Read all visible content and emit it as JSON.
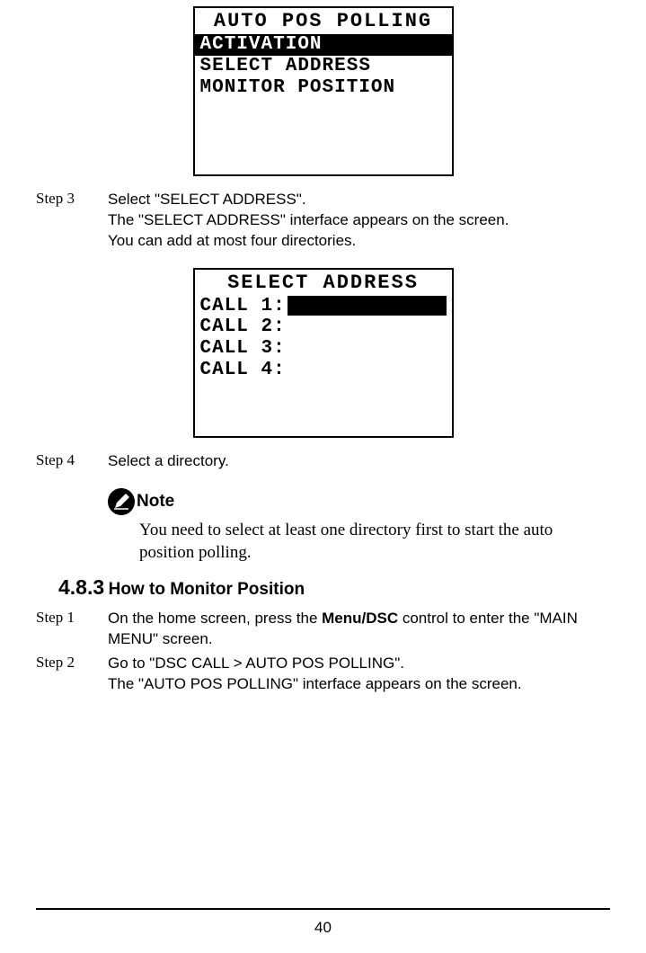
{
  "screen1": {
    "title": "AUTO POS POLLING",
    "items": [
      "ACTIVATION",
      "SELECT ADDRESS",
      "MONITOR POSITION"
    ]
  },
  "step3": {
    "label": "Step 3",
    "line1": "Select \"SELECT ADDRESS\".",
    "line2": "The \"SELECT ADDRESS\" interface appears on the screen.",
    "line3": "You can add at most four directories."
  },
  "screen2": {
    "title": "SELECT ADDRESS",
    "calls": [
      "CALL 1:",
      "CALL 2:",
      "CALL 3:",
      "CALL 4:"
    ]
  },
  "step4": {
    "label": "Step 4",
    "text": "Select a directory."
  },
  "note": {
    "title": "Note",
    "text": "You need to select at least one directory first to start the auto position polling."
  },
  "section": {
    "number": "4.8.3",
    "title": "How to Monitor Position"
  },
  "step1": {
    "label": "Step 1",
    "text_a": "On the home screen, press the ",
    "text_bold": "Menu/DSC",
    "text_b": " control to enter the \"MAIN MENU\" screen."
  },
  "step2": {
    "label": "Step 2",
    "line1": "Go to \"DSC CALL > AUTO POS POLLING\".",
    "line2": "The \"AUTO POS POLLING\" interface appears on the screen."
  },
  "page_number": "40"
}
